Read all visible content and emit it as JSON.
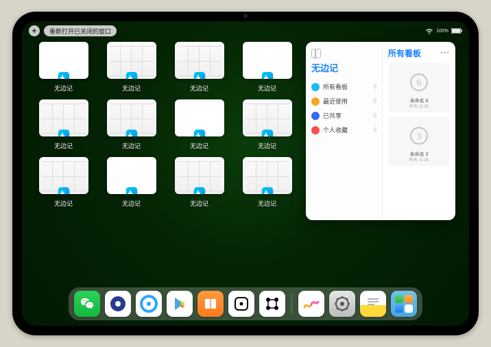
{
  "statusbar": {
    "time": "",
    "add_label": "+",
    "reopen_label": "重新打开已关闭的窗口",
    "battery_text": "100%"
  },
  "windows": {
    "app_name": "无边记",
    "items": [
      {
        "label": "无边记",
        "style": "blank"
      },
      {
        "label": "无边记",
        "style": "cal"
      },
      {
        "label": "无边记",
        "style": "cal"
      },
      {
        "label": "无边记",
        "style": "blank"
      },
      {
        "label": "无边记",
        "style": "cal"
      },
      {
        "label": "无边记",
        "style": "cal"
      },
      {
        "label": "无边记",
        "style": "blank"
      },
      {
        "label": "无边记",
        "style": "cal"
      },
      {
        "label": "无边记",
        "style": "cal"
      },
      {
        "label": "无边记",
        "style": "blank"
      },
      {
        "label": "无边记",
        "style": "cal"
      },
      {
        "label": "无边记",
        "style": "cal"
      }
    ]
  },
  "popover": {
    "sidebar": {
      "title": "无边记",
      "items": [
        {
          "label": "所有看板",
          "count": "0",
          "color": "#1bbcf0"
        },
        {
          "label": "最近使用",
          "count": "0",
          "color": "#f5a623"
        },
        {
          "label": "已共享",
          "count": "0",
          "color": "#3468ff"
        },
        {
          "label": "个人收藏",
          "count": "0",
          "color": "#ff4d4d"
        }
      ]
    },
    "main": {
      "title": "所有看板",
      "boards": [
        {
          "name": "未命名 6",
          "time": "昨天 11:25",
          "digit": "6"
        },
        {
          "name": "未命名 3",
          "time": "昨天 11:25",
          "digit": "3"
        }
      ]
    }
  },
  "dock": {
    "icons": [
      {
        "name": "wechat-icon"
      },
      {
        "name": "browser-icon-1"
      },
      {
        "name": "browser-icon-2"
      },
      {
        "name": "play-store-icon"
      },
      {
        "name": "books-icon"
      },
      {
        "name": "dice-icon"
      },
      {
        "name": "connect-icon"
      },
      {
        "name": "freeform-icon"
      },
      {
        "name": "settings-icon"
      },
      {
        "name": "notes-icon"
      },
      {
        "name": "app-folder-icon"
      }
    ]
  }
}
